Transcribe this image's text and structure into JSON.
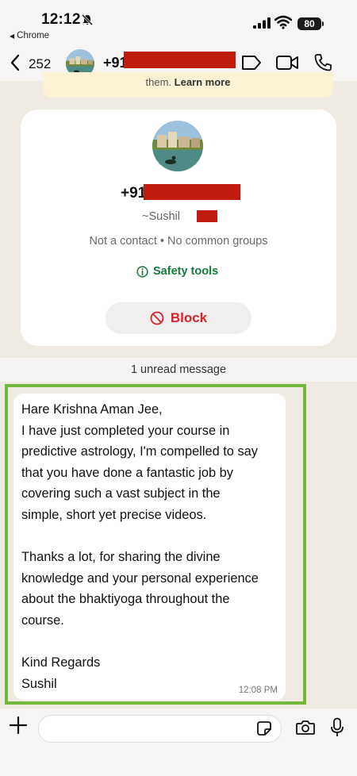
{
  "status_bar": {
    "time": "12:12",
    "back_app": "Chrome",
    "battery": "80"
  },
  "header": {
    "back_count": "252",
    "phone_prefix": "+91"
  },
  "banner": {
    "text": "them. ",
    "link": "Learn more"
  },
  "profile": {
    "phone_prefix": "+91",
    "push_name": "~Sushil",
    "subline": "Not a contact • No common groups",
    "safety_tools": "Safety tools",
    "block": "Block"
  },
  "unread_divider": "1 unread message",
  "message": {
    "lines": [
      "Hare Krishna Aman Jee,",
      "I have just completed your course in",
      "predictive astrology, I'm compelled to say",
      "that you have done a fantastic job by",
      "covering such a vast subject in the",
      "simple, short yet precise videos.",
      "",
      "Thanks a lot, for sharing the divine",
      "knowledge and your personal experience",
      "about the bhaktiyoga throughout the",
      "course.",
      "",
      "Kind Regards",
      "Sushil"
    ],
    "time": "12:08 PM"
  },
  "input": {
    "value": ""
  }
}
